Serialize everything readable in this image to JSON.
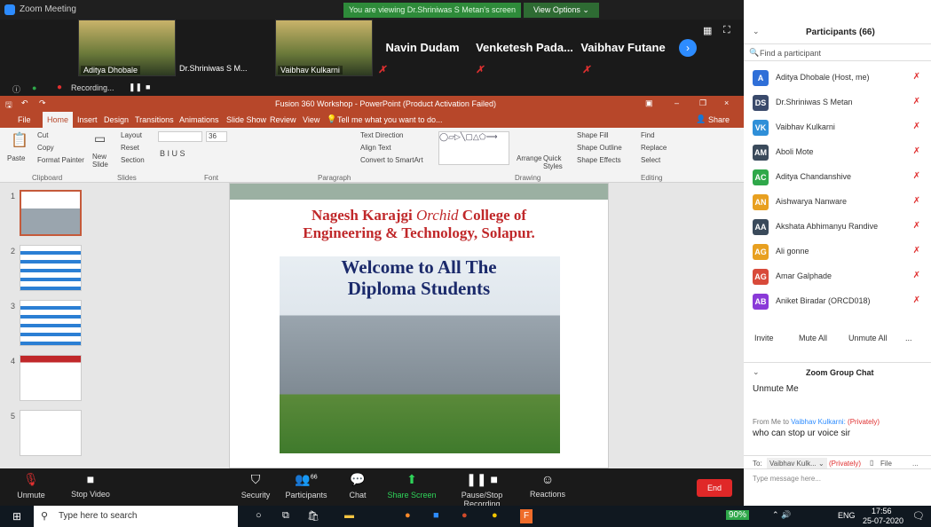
{
  "window": {
    "title": "Zoom Meeting",
    "share_banner": "You are viewing Dr.Shriniwas S Metan's screen",
    "view_options": "View Options ⌄"
  },
  "gallery": [
    {
      "name": "Aditya Dhobale",
      "type": "video"
    },
    {
      "name": "Dr.Shriniwas S M...",
      "type": "name"
    },
    {
      "name": "Vaibhav Kulkarni",
      "type": "video"
    },
    {
      "name": "Navin Dudam",
      "type": "name"
    },
    {
      "name": "Venketesh Pada...",
      "type": "name"
    },
    {
      "name": "Vaibhav Futane",
      "type": "name"
    }
  ],
  "recording": {
    "label": "Recording..."
  },
  "ppt": {
    "title": "Fusion 360 Workshop - PowerPoint (Product Activation Failed)",
    "menu": [
      "File",
      "Home",
      "Insert",
      "Design",
      "Transitions",
      "Animations",
      "Slide Show",
      "Review",
      "View"
    ],
    "tell_me": "Tell me what you want to do...",
    "share": "Share",
    "ribbon": {
      "clipboard": {
        "paste": "Paste",
        "cut": "Cut",
        "copy": "Copy",
        "format": "Format Painter",
        "label": "Clipboard"
      },
      "slides": {
        "new": "New Slide",
        "layout": "Layout",
        "reset": "Reset",
        "section": "Section",
        "label": "Slides"
      },
      "font": {
        "size": "36",
        "label": "Font"
      },
      "paragraph": {
        "dir": "Text Direction",
        "align": "Align Text",
        "smart": "Convert to SmartArt",
        "label": "Paragraph"
      },
      "drawing": {
        "arrange": "Arrange",
        "quick": "Quick Styles",
        "fill": "Shape Fill",
        "outline": "Shape Outline",
        "effects": "Shape Effects",
        "label": "Drawing"
      },
      "editing": {
        "find": "Find",
        "replace": "Replace",
        "select": "Select",
        "label": "Editing"
      }
    },
    "slide_numbers": [
      "1",
      "2",
      "3",
      "4",
      "5"
    ],
    "slide": {
      "line1a": "Nagesh Karajgi",
      "line1b": "Orchid",
      "line1c": "College of",
      "line2": "Engineering & Technology, Solapur.",
      "welcome1": "Welcome to All The",
      "welcome2": "Diploma Students"
    }
  },
  "participants": {
    "header": "Participants (66)",
    "search_placeholder": "Find a participant",
    "list": [
      {
        "initials": "A",
        "name": "Aditya Dhobale (Host, me)",
        "color": "#2f6fd8"
      },
      {
        "initials": "DS",
        "name": "Dr.Shriniwas S Metan",
        "color": "#3a4a6b"
      },
      {
        "initials": "VK",
        "name": "Vaibhav Kulkarni",
        "color": "#2f8fd8"
      },
      {
        "initials": "AM",
        "name": "Aboli Mote",
        "color": "#3a4a5b"
      },
      {
        "initials": "AC",
        "name": "Aditya Chandanshive",
        "color": "#2fa84a"
      },
      {
        "initials": "AN",
        "name": "Aishwarya Nanware",
        "color": "#e8a020"
      },
      {
        "initials": "AA",
        "name": "Akshata Abhimanyu Randive",
        "color": "#3a4a5b"
      },
      {
        "initials": "AG",
        "name": "Ali gonne",
        "color": "#e8a020"
      },
      {
        "initials": "AG",
        "name": "Amar Galphade",
        "color": "#d84a3a"
      },
      {
        "initials": "AB",
        "name": "Aniket Biradar (ORCD018)",
        "color": "#8a3ad8"
      }
    ],
    "invite": "Invite",
    "mute_all": "Mute All",
    "unmute_all": "Unmute All",
    "more": "..."
  },
  "chat": {
    "header": "Zoom Group Chat",
    "msg1": "Unmute Me",
    "from_prefix": "From Me to ",
    "from_name": "Vaibhav Kulkarni:",
    "private": "(Privately)",
    "msg2": "who can stop ur voice sir",
    "to_label": "To:",
    "to_value": "Vaibhav Kulk... ⌄",
    "to_private": "(Privately)",
    "file": "File",
    "more": "...",
    "input_placeholder": "Type message here..."
  },
  "bottom": {
    "unmute": "Unmute",
    "stop_video": "Stop Video",
    "security": "Security",
    "participants": "Participants",
    "participants_count": "66",
    "chat": "Chat",
    "share": "Share Screen",
    "record": "Pause/Stop Recording",
    "reactions": "Reactions",
    "end": "End"
  },
  "taskbar": {
    "search_placeholder": "Type here to search",
    "battery": "90%",
    "lang": "ENG",
    "time": "17:56",
    "date": "25-07-2020"
  }
}
